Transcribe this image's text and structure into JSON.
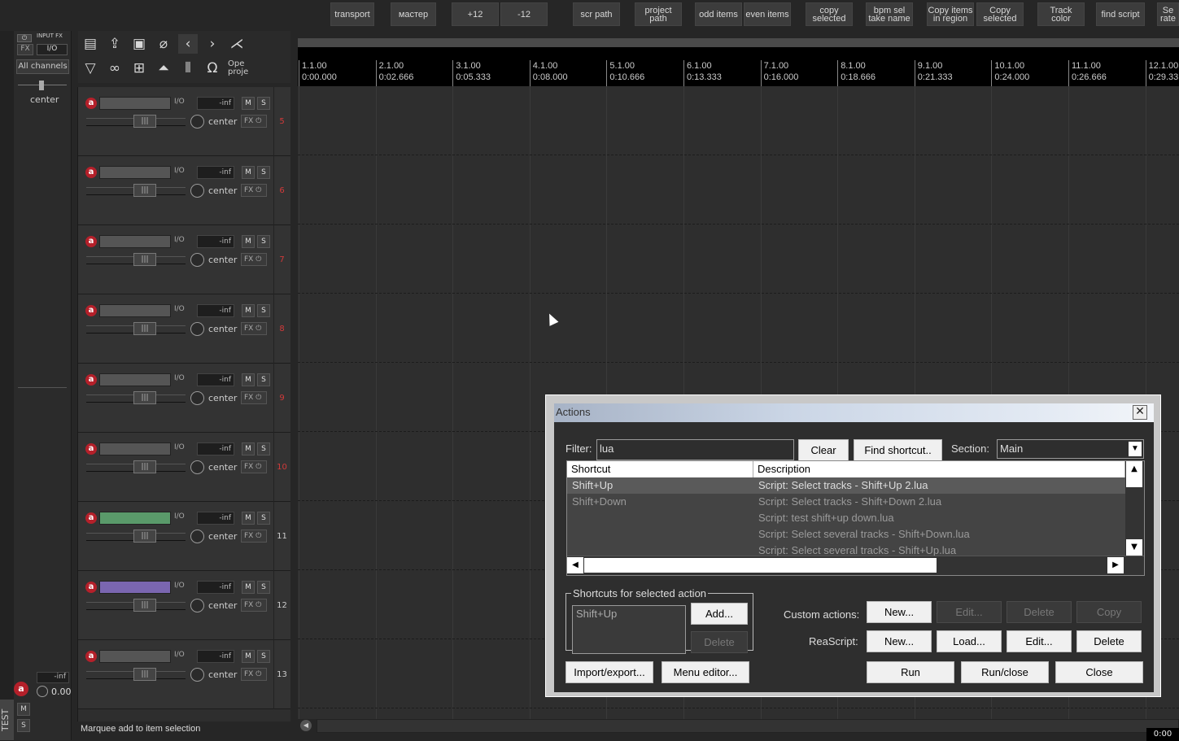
{
  "toolbar_buttons": [
    "transport",
    "мастер",
    "+12",
    "-12",
    "scr path",
    "project\npath",
    "odd items",
    "even items",
    "copy\nselected",
    "bpm sel\ntake name",
    "Copy items\nin region",
    "Copy\nselected",
    "Track\ncolor",
    "find script",
    "Se\nrate"
  ],
  "master": {
    "input_fx": "INPUT FX",
    "fx_label": "FX",
    "io_label": "I/O",
    "channels": "All channels",
    "pan": "center",
    "vol": "-inf",
    "vol_value": "0.00",
    "m": "M",
    "s": "S",
    "track_name": "TEST"
  },
  "main_toolbar": {
    "open_project": "Ope\nproje"
  },
  "tracks": [
    {
      "num": "5",
      "vol": "-inf",
      "io": "I/O",
      "pan": "center",
      "fx": "FX",
      "m": "M",
      "s": "S",
      "color": "#555555",
      "numcolor": "#d23a3a"
    },
    {
      "num": "6",
      "vol": "-inf",
      "io": "I/O",
      "pan": "center",
      "fx": "FX",
      "m": "M",
      "s": "S",
      "color": "#555555",
      "numcolor": "#d23a3a"
    },
    {
      "num": "7",
      "vol": "-inf",
      "io": "I/O",
      "pan": "center",
      "fx": "FX",
      "m": "M",
      "s": "S",
      "color": "#555555",
      "numcolor": "#d23a3a"
    },
    {
      "num": "8",
      "vol": "-inf",
      "io": "I/O",
      "pan": "center",
      "fx": "FX",
      "m": "M",
      "s": "S",
      "color": "#555555",
      "numcolor": "#d23a3a"
    },
    {
      "num": "9",
      "vol": "-inf",
      "io": "I/O",
      "pan": "center",
      "fx": "FX",
      "m": "M",
      "s": "S",
      "color": "#555555",
      "numcolor": "#d23a3a"
    },
    {
      "num": "10",
      "vol": "-inf",
      "io": "I/O",
      "pan": "center",
      "fx": "FX",
      "m": "M",
      "s": "S",
      "color": "#555555",
      "numcolor": "#d23a3a"
    },
    {
      "num": "11",
      "vol": "-inf",
      "io": "I/O",
      "pan": "center",
      "fx": "FX",
      "m": "M",
      "s": "S",
      "color": "#5a9a6a",
      "numcolor": "#cccccc"
    },
    {
      "num": "12",
      "vol": "-inf",
      "io": "I/O",
      "pan": "center",
      "fx": "FX",
      "m": "M",
      "s": "S",
      "color": "#7a66b0",
      "numcolor": "#cccccc"
    },
    {
      "num": "13",
      "vol": "-inf",
      "io": "I/O",
      "pan": "center",
      "fx": "FX",
      "m": "M",
      "s": "S",
      "color": "#555555",
      "numcolor": "#cccccc"
    }
  ],
  "ruler": [
    {
      "bar": "1.1.00",
      "time": "0:00.000"
    },
    {
      "bar": "2.1.00",
      "time": "0:02.666"
    },
    {
      "bar": "3.1.00",
      "time": "0:05.333"
    },
    {
      "bar": "4.1.00",
      "time": "0:08.000"
    },
    {
      "bar": "5.1.00",
      "time": "0:10.666"
    },
    {
      "bar": "6.1.00",
      "time": "0:13.333"
    },
    {
      "bar": "7.1.00",
      "time": "0:16.000"
    },
    {
      "bar": "8.1.00",
      "time": "0:18.666"
    },
    {
      "bar": "9.1.00",
      "time": "0:21.333"
    },
    {
      "bar": "10.1.00",
      "time": "0:24.000"
    },
    {
      "bar": "11.1.00",
      "time": "0:26.666"
    },
    {
      "bar": "12.1.00",
      "time": "0:29.33"
    }
  ],
  "status": "Marquee add to item selection",
  "playrate": "0:00",
  "dialog": {
    "title": "Actions",
    "close": "✕",
    "filter_label": "Filter:",
    "filter_value": "lua",
    "clear": "Clear",
    "find_shortcut": "Find shortcut..",
    "section_label": "Section:",
    "section_value": "Main",
    "col_shortcut": "Shortcut",
    "col_description": "Description",
    "rows": [
      {
        "shortcut": "Shift+Up",
        "description": "Script: Select tracks - Shift+Up 2.lua"
      },
      {
        "shortcut": "Shift+Down",
        "description": "Script: Select tracks - Shift+Down 2.lua"
      },
      {
        "shortcut": "",
        "description": "Script: test shift+up down.lua"
      },
      {
        "shortcut": "",
        "description": "Script: Select several tracks - Shift+Down.lua"
      },
      {
        "shortcut": "",
        "description": "Script: Select several tracks - Shift+Up.lua"
      }
    ],
    "shortcuts_group": "Shortcuts for selected action",
    "shortcut_current": "Shift+Up",
    "add": "Add...",
    "delete": "Delete",
    "custom_actions": "Custom actions:",
    "reascript": "ReaScript:",
    "ca_new": "New...",
    "ca_edit": "Edit...",
    "ca_delete": "Delete",
    "ca_copy": "Copy",
    "rs_new": "New...",
    "rs_load": "Load...",
    "rs_edit": "Edit...",
    "rs_delete": "Delete",
    "import_export": "Import/export...",
    "menu_editor": "Menu editor...",
    "run": "Run",
    "run_close": "Run/close",
    "close_btn": "Close"
  }
}
